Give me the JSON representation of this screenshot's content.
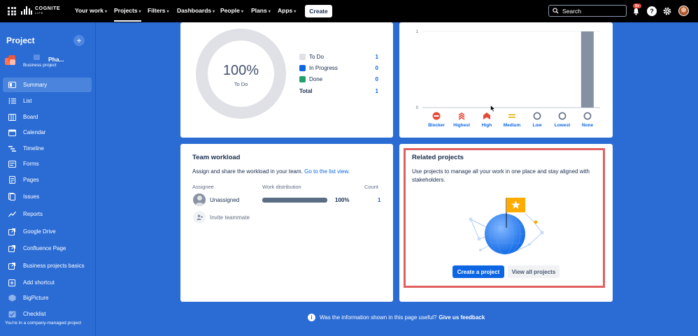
{
  "topnav": {
    "logo_text": "COGNITE",
    "logo_sub": "LIFE",
    "items": [
      {
        "label": "Your work"
      },
      {
        "label": "Projects"
      },
      {
        "label": "Filters"
      },
      {
        "label": "Dashboards"
      },
      {
        "label": "People"
      },
      {
        "label": "Plans"
      },
      {
        "label": "Apps"
      }
    ],
    "create_label": "Create",
    "search_placeholder": "Search",
    "notification_badge": "9+",
    "help_glyph": "?"
  },
  "sidebar": {
    "heading": "Project",
    "add_glyph": "+",
    "project_name": "Pha...",
    "project_type": "Business project",
    "items": [
      {
        "label": "Summary",
        "icon": "summary-icon",
        "active": true
      },
      {
        "label": "List",
        "icon": "list-icon"
      },
      {
        "label": "Board",
        "icon": "board-icon"
      },
      {
        "label": "Calendar",
        "icon": "calendar-icon"
      },
      {
        "label": "Timeline",
        "icon": "timeline-icon"
      },
      {
        "label": "Forms",
        "icon": "forms-icon"
      },
      {
        "label": "Pages",
        "icon": "pages-icon"
      },
      {
        "label": "Issues",
        "icon": "issues-icon"
      },
      {
        "label": "Reports",
        "icon": "reports-icon"
      },
      {
        "label": "Google Drive",
        "icon": "external-link-icon"
      },
      {
        "label": "Confluence Page",
        "icon": "external-link-icon"
      },
      {
        "label": "Business projects basics",
        "icon": "external-link-icon"
      },
      {
        "label": "Add shortcut",
        "icon": "add-shortcut-icon"
      },
      {
        "label": "BigPicture",
        "icon": "bigpicture-icon"
      },
      {
        "label": "Checklist",
        "icon": "checklist-icon"
      }
    ],
    "footer": "You're in a company-managed project"
  },
  "status_overview": {
    "donut_percent": "100%",
    "donut_label": "To Do",
    "legend": [
      {
        "label": "To Do",
        "count": "1",
        "color": "#dfe1e6"
      },
      {
        "label": "In Progress",
        "count": "0",
        "color": "#0c66e4"
      },
      {
        "label": "Done",
        "count": "0",
        "color": "#22a06b"
      }
    ],
    "total_label": "Total",
    "total_count": "1"
  },
  "priority_breakdown": {
    "chart_data": {
      "type": "bar",
      "categories": [
        "Blocker",
        "Highest",
        "High",
        "Medium",
        "Low",
        "Lowest",
        "None"
      ],
      "values": [
        0,
        0,
        0,
        0,
        0,
        0,
        1
      ],
      "ylim": [
        0,
        1
      ],
      "yticks": [
        "0",
        "1"
      ],
      "colors": {
        "bar": "#8590a2",
        "blocker": "#e5493a",
        "highest": "#e5493a",
        "high": "#e5493a",
        "medium": "#e2b203",
        "low": "#8590a2",
        "lowest": "#8590a2",
        "none": "#8590a2"
      }
    }
  },
  "team_workload": {
    "title": "Team workload",
    "description": "Assign and share the workload in your team.",
    "link": "Go to the list view.",
    "col_assignee": "Assignee",
    "col_distribution": "Work distribution",
    "col_count": "Count",
    "row_name": "Unassigned",
    "row_percent": "100%",
    "row_fraction": 1.0,
    "row_count": "1",
    "invite_label": "Invite teammate"
  },
  "related_projects": {
    "title": "Related projects",
    "description": "Use projects to manage all your work in one place and stay aligned with stakeholders.",
    "create_label": "Create a project",
    "view_label": "View all projects"
  },
  "feedback": {
    "info_glyph": "i",
    "question": "Was the information shown in this page useful?",
    "link": "Give us feedback"
  }
}
